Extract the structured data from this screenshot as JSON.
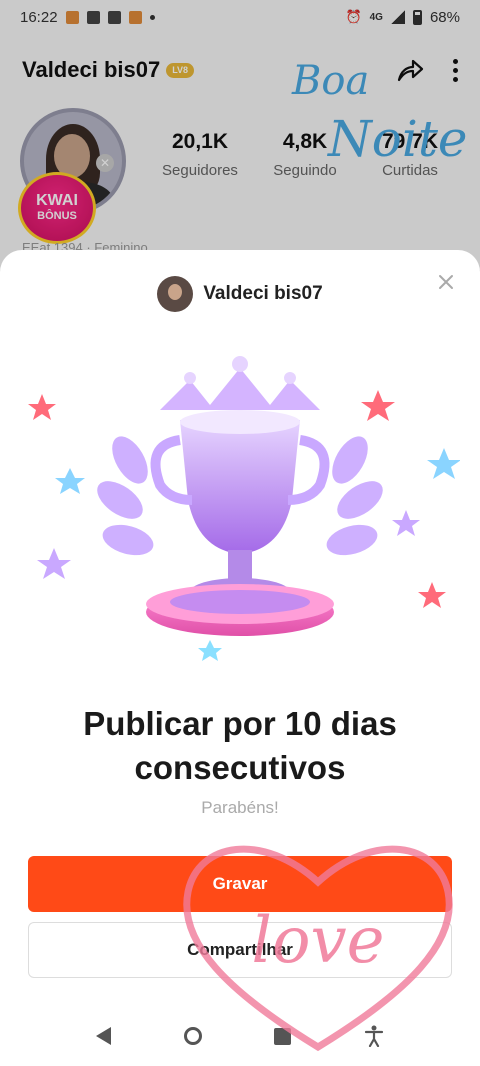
{
  "status_bar": {
    "time": "16:22",
    "network": "4G",
    "battery": "68%"
  },
  "profile": {
    "name": "Valdeci bis07",
    "level": "LV8",
    "stats": [
      {
        "value": "20,1K",
        "label": "Seguidores"
      },
      {
        "value": "4,8K",
        "label": "Seguindo"
      },
      {
        "value": "79,7K",
        "label": "Curtidas"
      }
    ],
    "sub_text": "EEat 1394 · Feminino",
    "bonus_badge": {
      "line1": "KWAI",
      "line2": "BÔNUS"
    }
  },
  "sticker_boa_noite": {
    "line1": "Boa",
    "line2": "Noite"
  },
  "sheet": {
    "username": "Valdeci bis07",
    "title_line1": "Publicar por 10 dias",
    "title_line2": "consecutivos",
    "subtitle": "Parabéns!",
    "primary_button": "Gravar",
    "secondary_button": "Compartilhar"
  },
  "love_sticker": {
    "text": "love"
  },
  "colors": {
    "primary": "#ff4a17",
    "trophy": "#c58cf0",
    "sticker_blue": "#4aa8e0",
    "sticker_pink": "#f07a9a"
  },
  "icons": [
    "share-icon",
    "more-icon",
    "close-icon",
    "back-icon",
    "home-icon",
    "recent-apps-icon",
    "accessibility-icon",
    "trophy-icon"
  ]
}
